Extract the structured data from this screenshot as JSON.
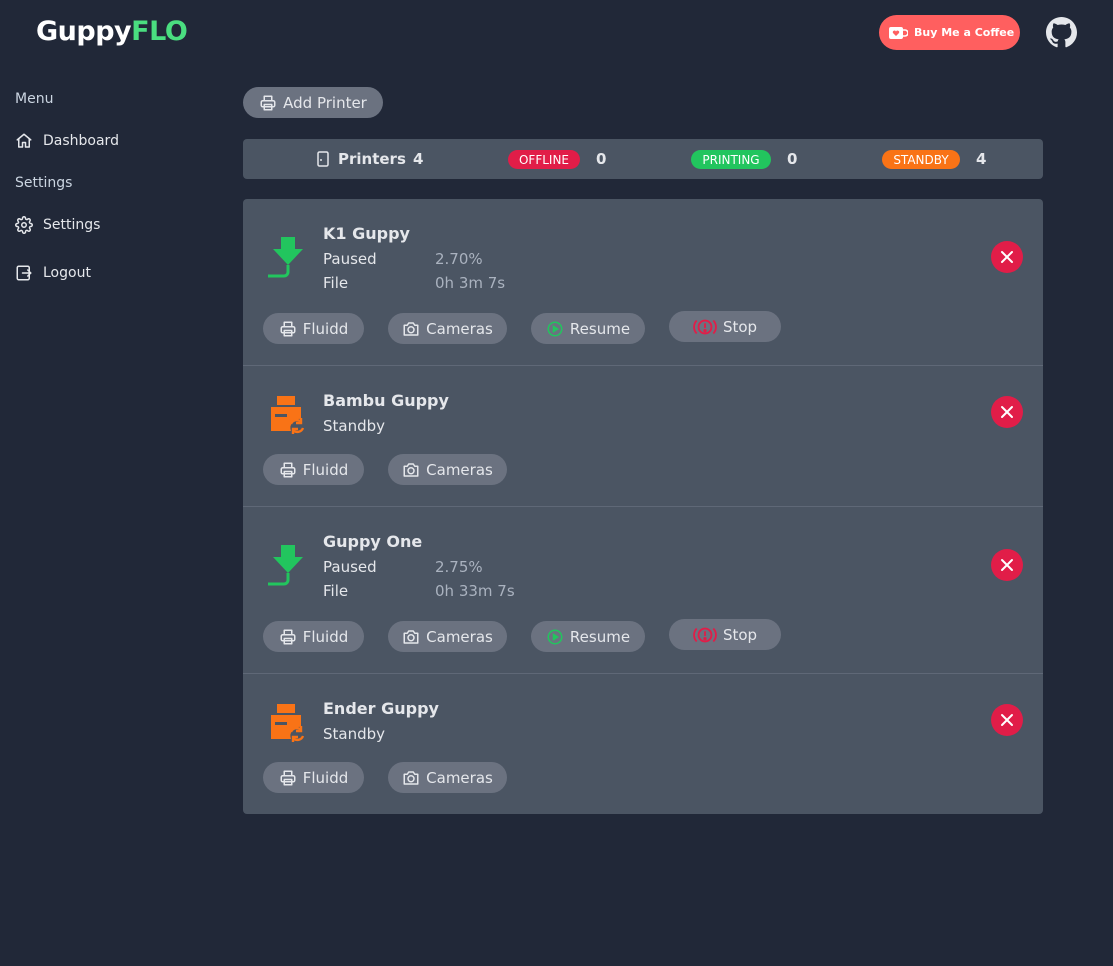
{
  "app": {
    "name_part1": "Guppy",
    "name_part2": "FLO"
  },
  "header": {
    "coffee_label": "Buy Me a Coffee",
    "github_icon": "github-icon"
  },
  "sidebar": {
    "menu_heading": "Menu",
    "dashboard_label": "Dashboard",
    "settings_heading": "Settings",
    "settings_label": "Settings",
    "logout_label": "Logout"
  },
  "toolbar": {
    "add_printer_label": "Add Printer"
  },
  "stats": {
    "printers_label": "Printers",
    "printers_count": "4",
    "offline_label": "OFFLINE",
    "offline_count": "0",
    "printing_label": "PRINTING",
    "printing_count": "0",
    "standby_label": "STANDBY",
    "standby_count": "4",
    "colors": {
      "offline": "#e11d48",
      "printing": "#22c55e",
      "standby": "#f97316"
    }
  },
  "printers": [
    {
      "name": "K1 Guppy",
      "state": "Paused",
      "progress": "2.70%",
      "file_label": "File",
      "time": "0h 3m 7s",
      "fluidd_label": "Fluidd",
      "cameras_label": "Cameras",
      "resume_label": "Resume",
      "stop_label": "Stop",
      "icon": "printing-download-icon"
    },
    {
      "name": "Bambu Guppy",
      "state": "Standby",
      "fluidd_label": "Fluidd",
      "cameras_label": "Cameras",
      "icon": "printer-standby-icon"
    },
    {
      "name": "Guppy One",
      "state": "Paused",
      "progress": "2.75%",
      "file_label": "File",
      "time": "0h 33m 7s",
      "fluidd_label": "Fluidd",
      "cameras_label": "Cameras",
      "resume_label": "Resume",
      "stop_label": "Stop",
      "icon": "printing-download-icon"
    },
    {
      "name": "Ender Guppy",
      "state": "Standby",
      "fluidd_label": "Fluidd",
      "cameras_label": "Cameras",
      "icon": "printer-standby-icon"
    }
  ]
}
